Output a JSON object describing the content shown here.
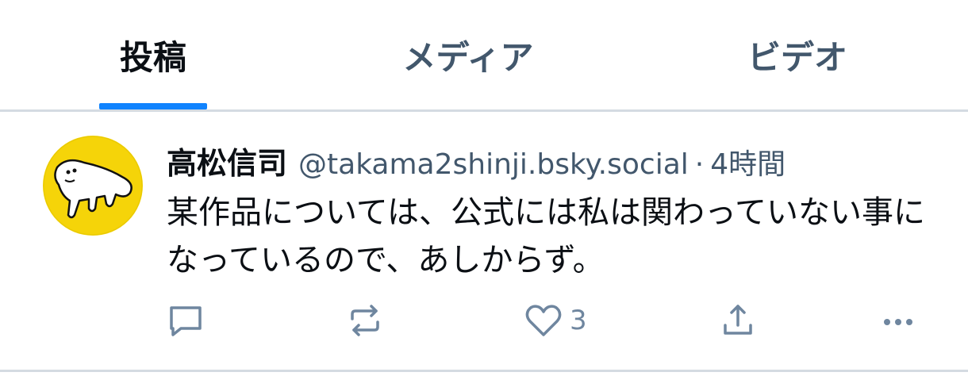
{
  "tabs": [
    {
      "label": "投稿",
      "active": true
    },
    {
      "label": "メディア",
      "active": false
    },
    {
      "label": "ビデオ",
      "active": false
    }
  ],
  "post": {
    "display_name": "高松信司",
    "handle": "@takama2shinji.bsky.social",
    "separator": "·",
    "time": "4時間",
    "text": "某作品については、公式には私は関わっていない事になっているので、あしからず。",
    "avatar_icon": "drawn-character-avatar",
    "actions": {
      "reply_icon": "reply-icon",
      "repost_icon": "repost-icon",
      "like_icon": "heart-icon",
      "like_count": "3",
      "share_icon": "share-icon",
      "more_icon": "more-icon"
    }
  },
  "colors": {
    "accent": "#1083fe",
    "muted": "#42576c",
    "icon": "#6f869f",
    "divider": "#d4dbe2",
    "avatar_bg": "#f5d409"
  }
}
